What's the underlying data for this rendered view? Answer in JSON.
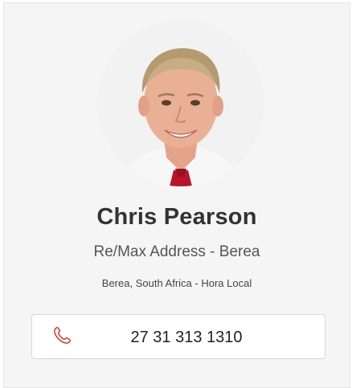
{
  "agent": {
    "name": "Chris Pearson",
    "agency": "Re/Max Address - Berea",
    "location": "Berea, South Africa - Hora Local",
    "phone": "27 31 313 1310",
    "photo": "agent-portrait"
  },
  "icons": {
    "phone": "phone-icon"
  },
  "colors": {
    "card_background": "#f5f5f5",
    "phone_icon": "#d9261c",
    "name_text": "#333333"
  }
}
